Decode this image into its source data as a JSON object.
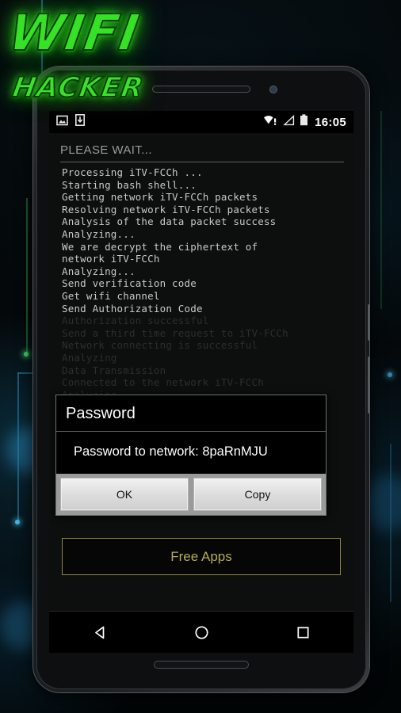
{
  "logo": {
    "line1": "WIFI",
    "line2": "HACKER",
    "color": "#36e226"
  },
  "statusbar": {
    "icons_left": [
      "image-icon",
      "download-icon"
    ],
    "icons_right": [
      "wifi-alert-icon",
      "signal-icon",
      "battery-icon"
    ],
    "clock": "16:05"
  },
  "app": {
    "header": "PLEASE WAIT...",
    "terminal_lines": [
      "Processing iTV-FCCh ...",
      "Starting bash shell...",
      "Getting network iTV-FCCh packets",
      "Resolving network iTV-FCCh packets",
      "Analysis of the data packet success",
      "Analyzing...",
      "We are decrypt the ciphertext of",
      "network iTV-FCCh",
      "Analyzing...",
      "Send verification code",
      "Get wifi channel",
      "Send Authorization Code"
    ],
    "terminal_lines_dim": [
      "Authorization successful",
      "Send a third time request to iTV-FCCh",
      "Network connecting is successful",
      "Analyzing",
      "Data Transmission",
      "Connected to the network iTV-FCCh",
      "Analyzing"
    ],
    "free_apps_label": "Free Apps",
    "free_apps_color": "#b3ad52"
  },
  "dialog": {
    "title": "Password",
    "message": "Password to network: 8paRnMJU",
    "network_name": "iTV-FCCh",
    "password": "8paRnMJU",
    "buttons": [
      {
        "label": "OK",
        "name": "ok-button"
      },
      {
        "label": "Copy",
        "name": "copy-button"
      }
    ]
  },
  "navbar": {
    "back": "back-icon",
    "home": "home-icon",
    "recents": "recents-icon"
  }
}
